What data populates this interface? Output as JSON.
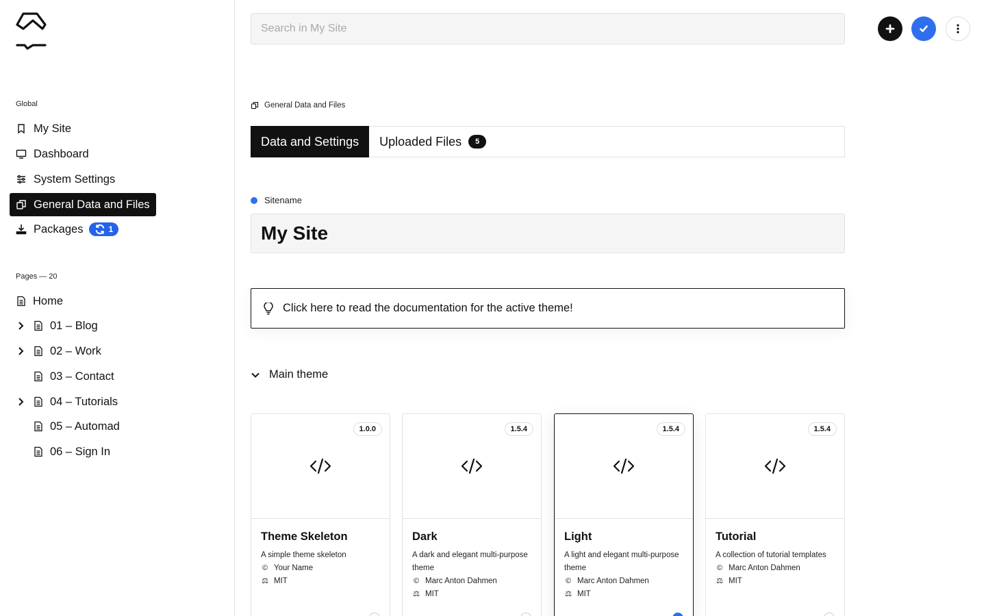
{
  "search": {
    "placeholder": "Search in My Site"
  },
  "header_buttons": {
    "add_icon": "plus-icon",
    "save_icon": "check-icon",
    "more_icon": "more-vertical-icon"
  },
  "sidebar": {
    "global_heading": "Global",
    "items": [
      {
        "label": "My Site",
        "icon": "bookmark-icon"
      },
      {
        "label": "Dashboard",
        "icon": "monitor-icon"
      },
      {
        "label": "System Settings",
        "icon": "sliders-icon"
      },
      {
        "label": "General Data and Files",
        "icon": "files-icon",
        "active": true
      },
      {
        "label": "Packages",
        "icon": "download-icon",
        "badge": "1"
      }
    ],
    "pages_heading": "Pages — 20",
    "pages": [
      {
        "label": "Home",
        "expandable": false
      },
      {
        "label": "01 – Blog",
        "expandable": true
      },
      {
        "label": "02 – Work",
        "expandable": true
      },
      {
        "label": "03 – Contact",
        "expandable": false
      },
      {
        "label": "04 – Tutorials",
        "expandable": true
      },
      {
        "label": "05 – Automad",
        "expandable": false
      },
      {
        "label": "06 – Sign In",
        "expandable": false
      }
    ]
  },
  "breadcrumb": "General Data and Files",
  "tabs": [
    {
      "label": "Data and Settings",
      "active": true
    },
    {
      "label": "Uploaded Files",
      "count": "5"
    }
  ],
  "sitename": {
    "label": "Sitename",
    "value": "My Site",
    "dot_color": "#2f6fed"
  },
  "doc_link": "Click here to read the documentation for the active theme!",
  "main_theme_label": "Main theme",
  "themes": [
    {
      "name": "Theme Skeleton",
      "version": "1.0.0",
      "description": "A simple theme skeleton",
      "author": "Your Name",
      "license": "MIT",
      "selected": false
    },
    {
      "name": "Dark",
      "version": "1.5.4",
      "description": "A dark and elegant multi-purpose theme",
      "author": "Marc Anton Dahmen",
      "license": "MIT",
      "selected": false
    },
    {
      "name": "Light",
      "version": "1.5.4",
      "description": "A light and elegant multi-purpose theme",
      "author": "Marc Anton Dahmen",
      "license": "MIT",
      "selected": true
    },
    {
      "name": "Tutorial",
      "version": "1.5.4",
      "description": "A collection of tutorial templates",
      "author": "Marc Anton Dahmen",
      "license": "MIT",
      "selected": false
    }
  ],
  "colors": {
    "accent": "#2f6fed",
    "active_bg": "#111111"
  }
}
